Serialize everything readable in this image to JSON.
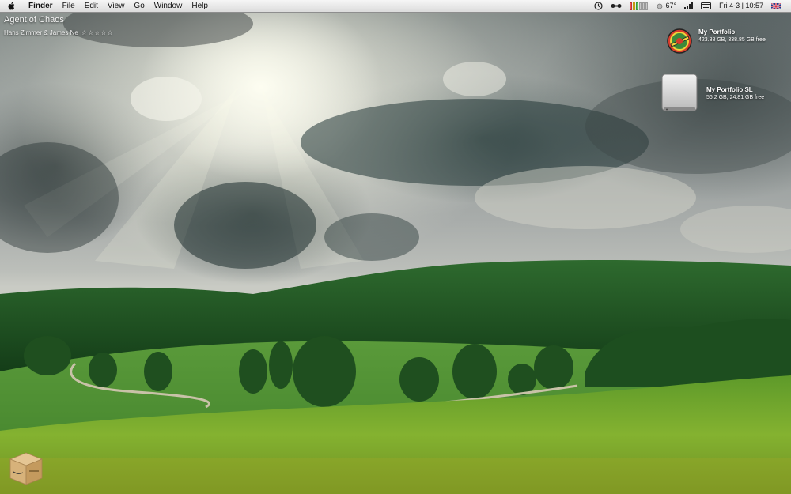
{
  "menubar": {
    "app_name": "Finder",
    "items": [
      "File",
      "Edit",
      "View",
      "Go",
      "Window",
      "Help"
    ],
    "status": {
      "temperature": "67°",
      "datetime": "Fri 4-3 | 10:57"
    }
  },
  "now_playing": {
    "title": "Agent of Chaos",
    "artist": "Hans Zimmer & James Ne",
    "rating": "☆☆☆☆☆"
  },
  "desktop": {
    "drives": [
      {
        "name": "My Portfolio",
        "info": "423.88 GB, 338.85 GB free",
        "icon": "planet-express-icon"
      },
      {
        "name": "My Portfolio SL",
        "info": "56.2 GB, 24.81 GB free",
        "icon": "hard-drive-icon"
      }
    ],
    "box_icon": "cardboard-box-icon"
  },
  "colors": {
    "menubar_top": "#f6f6f6",
    "menubar_bottom": "#dcdcdc",
    "foliage_dark": "#1f5a24",
    "grass": "#7fae2c"
  }
}
